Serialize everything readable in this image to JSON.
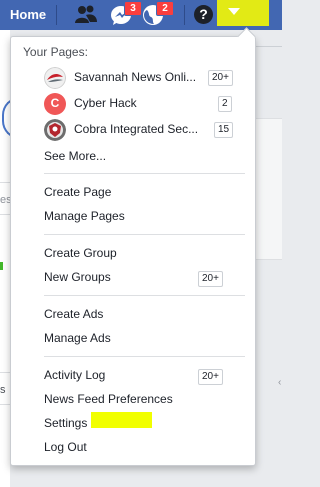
{
  "topbar": {
    "home_label": "Home",
    "icons": [
      "friends-icon",
      "messenger-icon",
      "notifications-globe-icon",
      "help-icon",
      "menu-caret-icon"
    ],
    "messages_badge": "3",
    "notifications_badge": "2",
    "help_glyph": "?",
    "color": "#4267b2"
  },
  "background": {
    "fragment_es": "es",
    "fragment_s": "s"
  },
  "dropdown": {
    "your_pages_title": "Your Pages:",
    "pages": [
      {
        "name": "Savannah News Onli...",
        "count": "20+",
        "avatar": "savannah-news-avatar"
      },
      {
        "name": "Cyber Hack",
        "count": "2",
        "avatar": "cyber-hack-avatar",
        "avatar_letter": "C"
      },
      {
        "name": "Cobra Integrated Sec...",
        "count": "15",
        "avatar": "cobra-integrated-avatar"
      }
    ],
    "see_more": "See More...",
    "groups": [
      {
        "items": [
          {
            "label": "Create Page"
          },
          {
            "label": "Manage Pages"
          }
        ]
      },
      {
        "items": [
          {
            "label": "Create Group"
          },
          {
            "label": "New Groups",
            "count": "20+"
          }
        ]
      },
      {
        "items": [
          {
            "label": "Create Ads"
          },
          {
            "label": "Manage Ads"
          }
        ]
      },
      {
        "items": [
          {
            "label": "Activity Log",
            "count": "20+"
          },
          {
            "label": "News Feed Preferences"
          },
          {
            "label": "Settings"
          },
          {
            "label": "Log Out"
          }
        ]
      }
    ],
    "highlight_color": "#f1ff00"
  }
}
